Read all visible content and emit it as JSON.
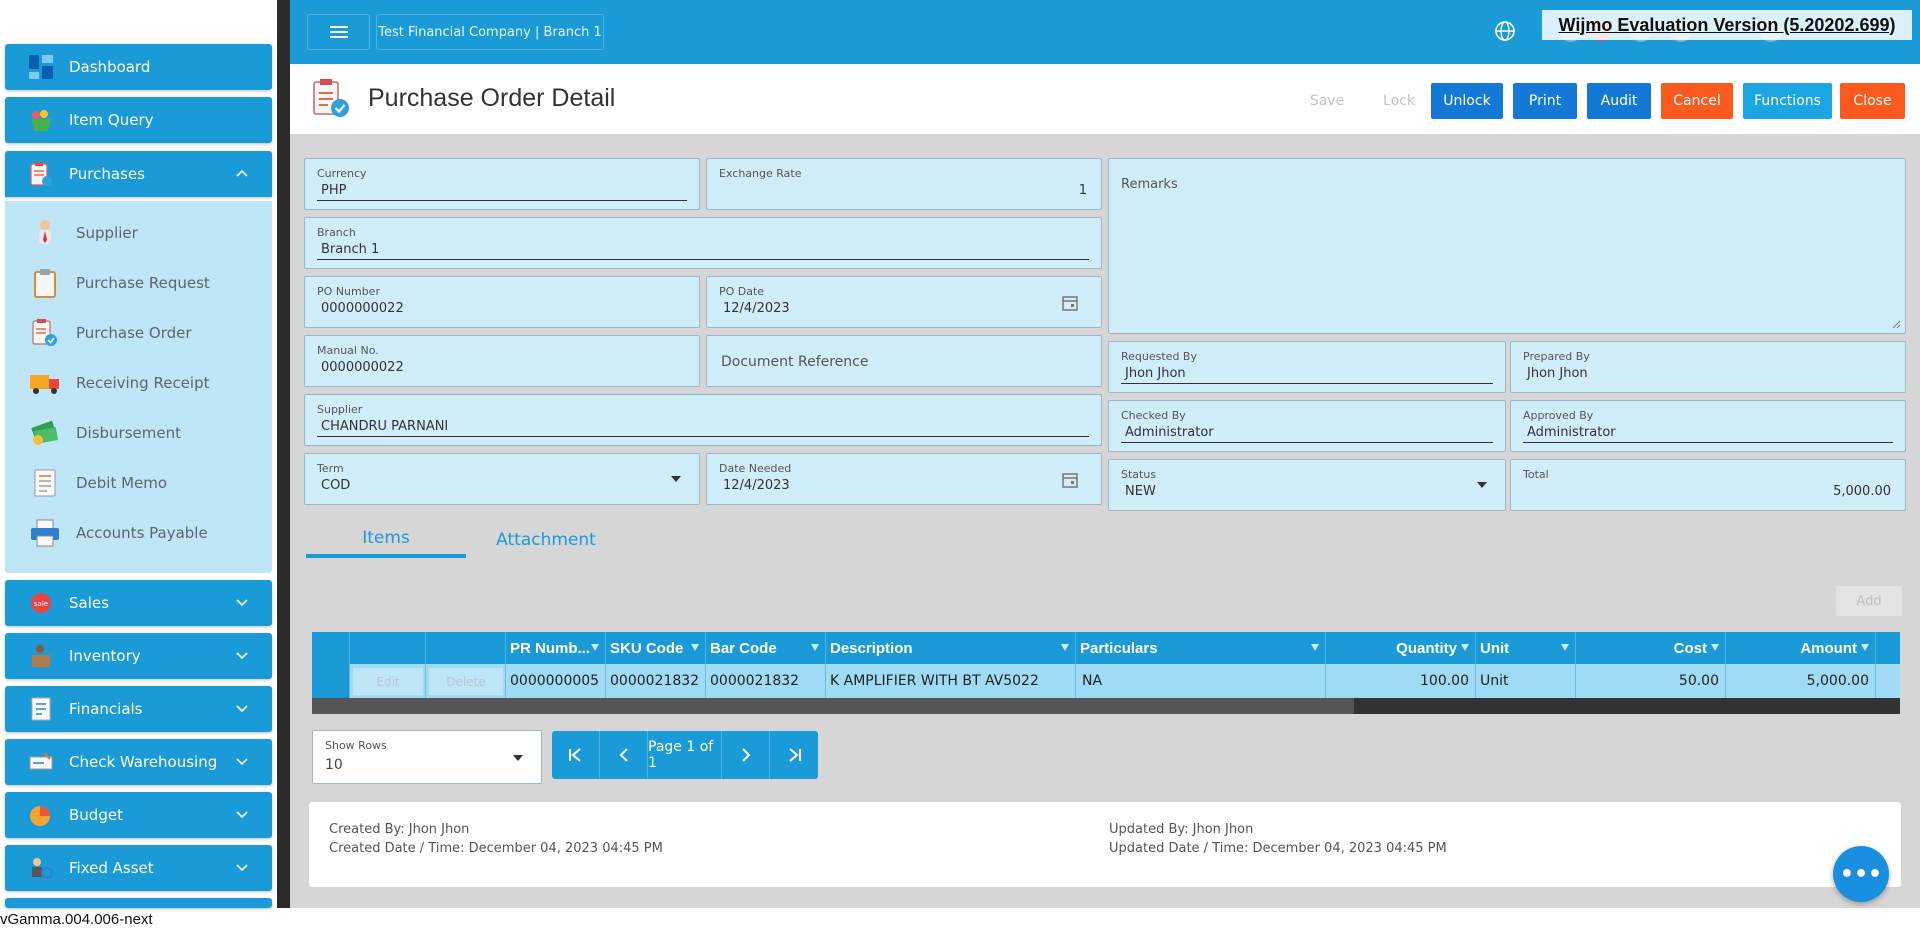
{
  "sidebar": {
    "main_top": [
      {
        "label": "Dashboard",
        "icon": "dashboard-icon"
      },
      {
        "label": "Item Query",
        "icon": "basket-icon"
      },
      {
        "label": "Purchases",
        "icon": "purchases-icon",
        "expanded": true
      }
    ],
    "purchases_sub": [
      {
        "label": "Supplier",
        "icon": "supplier-icon"
      },
      {
        "label": "Purchase Request",
        "icon": "clipboard-icon"
      },
      {
        "label": "Purchase Order",
        "icon": "purchase-order-icon"
      },
      {
        "label": "Receiving Receipt",
        "icon": "truck-icon"
      },
      {
        "label": "Disbursement",
        "icon": "money-icon"
      },
      {
        "label": "Debit Memo",
        "icon": "memo-icon"
      },
      {
        "label": "Accounts Payable",
        "icon": "printer-icon"
      }
    ],
    "main_bottom": [
      {
        "label": "Sales",
        "icon": "sales-icon"
      },
      {
        "label": "Inventory",
        "icon": "inventory-icon"
      },
      {
        "label": "Financials",
        "icon": "financials-icon"
      },
      {
        "label": "Check Warehousing",
        "icon": "check-icon"
      },
      {
        "label": "Budget",
        "icon": "budget-icon"
      },
      {
        "label": "Fixed Asset",
        "icon": "fixed-asset-icon"
      }
    ]
  },
  "version": "vGamma.004.006-next",
  "topbar": {
    "company": "Test Financial Company | Branch 1",
    "watermark": "Wijmo Evaluation Version (5.20202.699)"
  },
  "header": {
    "title": "Purchase Order Detail",
    "buttons": {
      "save": "Save",
      "lock": "Lock",
      "unlock": "Unlock",
      "print": "Print",
      "audit": "Audit",
      "cancel": "Cancel",
      "functions": "Functions",
      "close": "Close"
    }
  },
  "form": {
    "currency": {
      "label": "Currency",
      "value": "PHP"
    },
    "exchange_rate": {
      "label": "Exchange Rate",
      "value": "1"
    },
    "remarks": {
      "label": "Remarks",
      "value": ""
    },
    "branch": {
      "label": "Branch",
      "value": "Branch 1"
    },
    "po_number": {
      "label": "PO Number",
      "value": "0000000022"
    },
    "po_date": {
      "label": "PO Date",
      "value": "12/4/2023"
    },
    "manual_no": {
      "label": "Manual No.",
      "value": "0000000022"
    },
    "document_reference": {
      "label": "Document Reference",
      "value": ""
    },
    "requested_by": {
      "label": "Requested By",
      "value": "Jhon Jhon"
    },
    "prepared_by": {
      "label": "Prepared By",
      "value": "Jhon Jhon"
    },
    "supplier": {
      "label": "Supplier",
      "value": "CHANDRU PARNANI"
    },
    "checked_by": {
      "label": "Checked By",
      "value": "Administrator"
    },
    "approved_by": {
      "label": "Approved By",
      "value": "Administrator"
    },
    "term": {
      "label": "Term",
      "value": "COD"
    },
    "date_needed": {
      "label": "Date Needed",
      "value": "12/4/2023"
    },
    "status": {
      "label": "Status",
      "value": "NEW"
    },
    "total": {
      "label": "Total",
      "value": "5,000.00"
    }
  },
  "tabs": {
    "items": "Items",
    "attachment": "Attachment"
  },
  "add_button": "Add",
  "grid": {
    "columns": {
      "pr_number": "PR Numb...",
      "sku_code": "SKU Code",
      "bar_code": "Bar Code",
      "description": "Description",
      "particulars": "Particulars",
      "quantity": "Quantity",
      "unit": "Unit",
      "cost": "Cost",
      "amount": "Amount"
    },
    "row": {
      "edit": "Edit",
      "delete": "Delete",
      "pr_number": "0000000005",
      "sku_code": "0000021832",
      "bar_code": "0000021832",
      "description": "K AMPLIFIER WITH BT AV5022",
      "particulars": "NA",
      "quantity": "100.00",
      "unit": "Unit",
      "cost": "50.00",
      "amount": "5,000.00"
    }
  },
  "pager": {
    "show_rows_label": "Show Rows",
    "show_rows_value": "10",
    "page_label": "Page 1 of 1"
  },
  "footer": {
    "created_by": "Created By: Jhon Jhon",
    "created_date": "Created Date / Time: December 04, 2023 04:45 PM",
    "updated_by": "Updated By: Jhon Jhon",
    "updated_date": "Updated Date / Time: December 04, 2023 04:45 PM"
  },
  "colors": {
    "primary": "#1a9bd7",
    "button_blue": "#1479d6",
    "button_orange": "#fa5a1e",
    "field_bg": "#d0eefa"
  }
}
